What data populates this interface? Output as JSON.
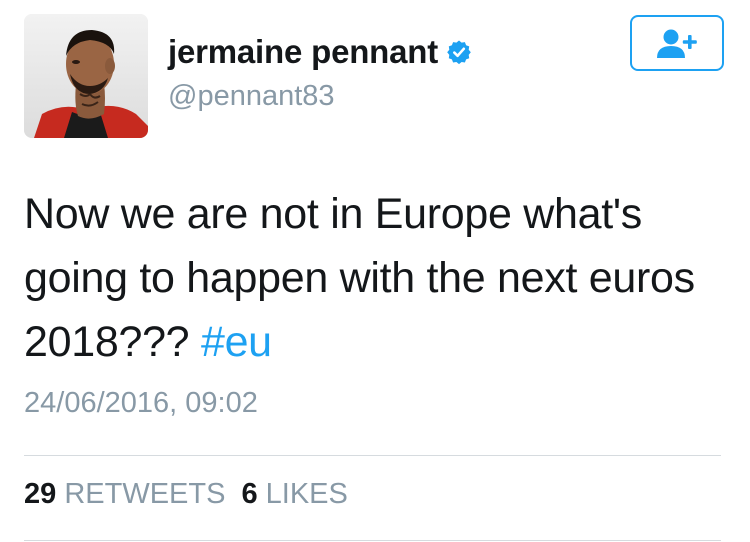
{
  "user": {
    "display_name": "jermaine pennant",
    "handle": "@pennant83",
    "verified": true,
    "avatar_icon": "profile-photo"
  },
  "follow_button": {
    "icon": "add-user-icon"
  },
  "tweet": {
    "text": "Now we are not in Europe what's going to happen with the next euros 2018??? ",
    "hashtag": "#eu",
    "timestamp": "24/06/2016, 09:02"
  },
  "stats": {
    "retweets_count": "29",
    "retweets_label": "RETWEETS",
    "likes_count": "6",
    "likes_label": "LIKES"
  },
  "colors": {
    "accent": "#1da1f2",
    "secondary_text": "#8899a6",
    "primary_text": "#14171a",
    "divider": "#d6dbdf"
  }
}
